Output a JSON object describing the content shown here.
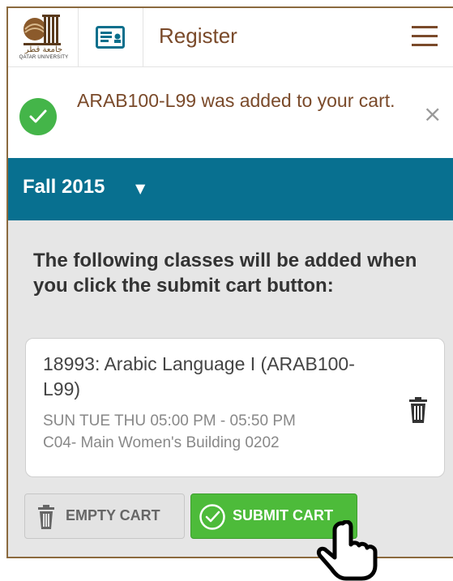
{
  "header": {
    "logo_arabic": "جامعة قطر",
    "logo_english": "QATAR UNIVERSITY",
    "title": "Register",
    "menu_icon": "hamburger-menu-icon",
    "card_icon": "id-card-icon"
  },
  "alert": {
    "message": "ARAB100-L99 was added to your cart.",
    "icon": "checkmark-circle-icon",
    "close_symbol": "×"
  },
  "term": {
    "label": "Fall 2015",
    "caret": "▼"
  },
  "cart": {
    "heading": "The following classes will be added when you click the submit cart button:",
    "classes": [
      {
        "title": "18993: Arabic Language I (ARAB100-L99)",
        "schedule": "SUN TUE THU 05:00 PM - 05:50 PM",
        "location": "C04- Main Women's Building 0202"
      }
    ]
  },
  "buttons": {
    "empty_cart": "EMPTY CART",
    "submit_cart": "SUBMIT CART"
  },
  "colors": {
    "brand_brown": "#7a4a2a",
    "term_bar": "#087090",
    "success_green": "#44b549",
    "submit_green": "#4dbb3a"
  }
}
